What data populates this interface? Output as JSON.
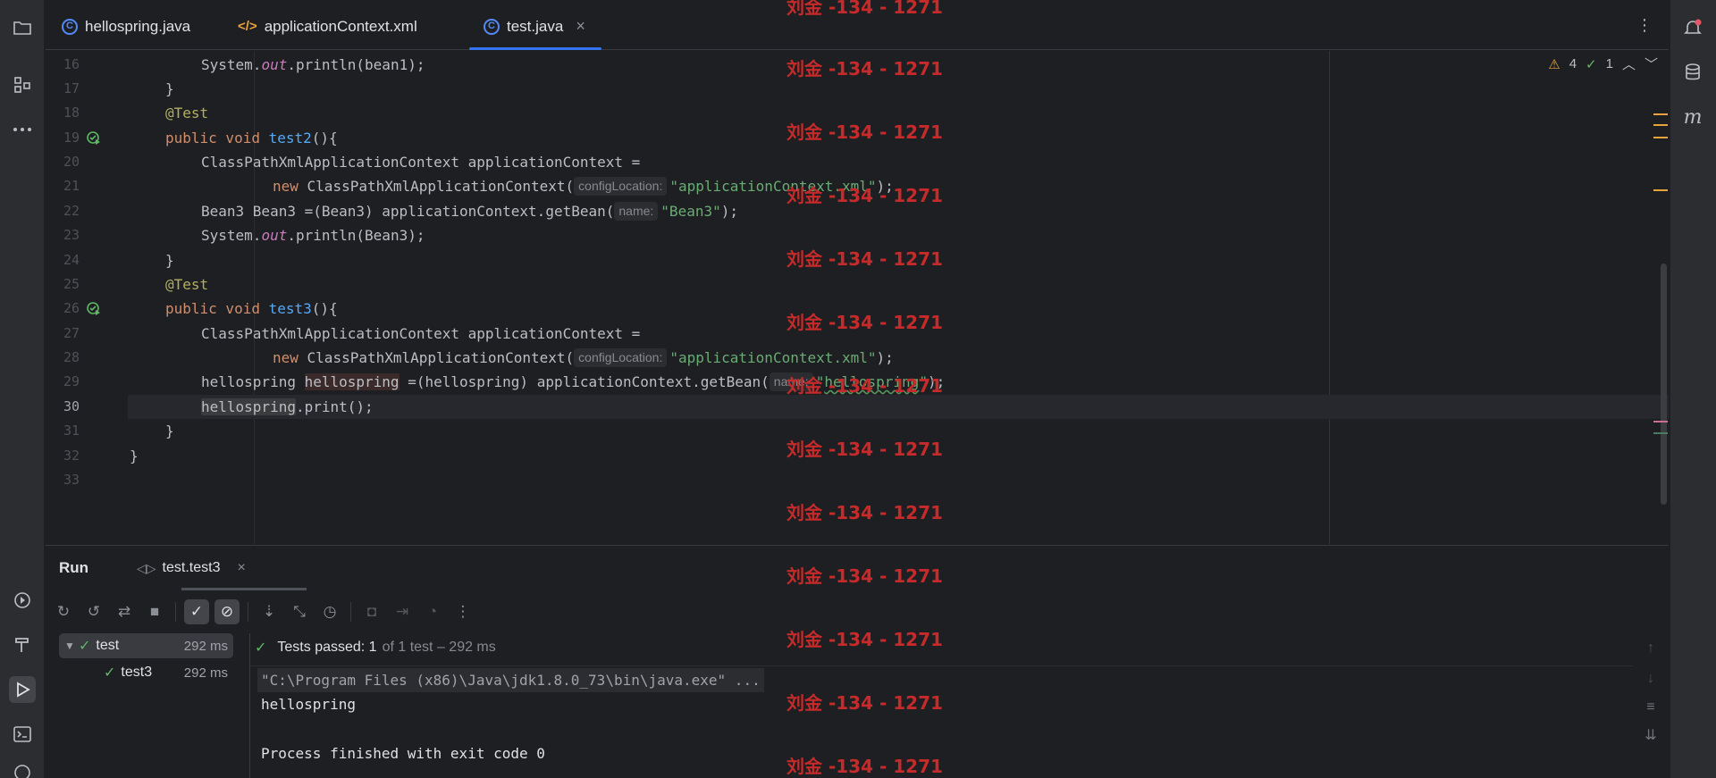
{
  "tabs": [
    {
      "label": "hellospring.java",
      "icon": "java-class-icon"
    },
    {
      "label": "applicationContext.xml",
      "icon": "xml-file-icon"
    },
    {
      "label": "test.java",
      "icon": "java-class-icon",
      "close": "×"
    }
  ],
  "inspections": {
    "warnings": "4",
    "weak_warnings": "1"
  },
  "editor": {
    "lines": [
      {
        "n": "16",
        "code": "System.out.println(bean1);"
      },
      {
        "n": "17",
        "code": "}"
      },
      {
        "n": "18",
        "code": "@Test"
      },
      {
        "n": "19",
        "code": "public void test2(){"
      },
      {
        "n": "20",
        "code": "ClassPathXmlApplicationContext applicationContext ="
      },
      {
        "n": "21",
        "code": "new ClassPathXmlApplicationContext( configLocation: \"applicationContext.xml\");"
      },
      {
        "n": "22",
        "code": "Bean3 Bean3 =(Bean3) applicationContext.getBean( name: \"Bean3\");"
      },
      {
        "n": "23",
        "code": "System.out.println(Bean3);"
      },
      {
        "n": "24",
        "code": "}"
      },
      {
        "n": "25",
        "code": "@Test"
      },
      {
        "n": "26",
        "code": "public void test3(){"
      },
      {
        "n": "27",
        "code": "ClassPathXmlApplicationContext applicationContext ="
      },
      {
        "n": "28",
        "code": "new ClassPathXmlApplicationContext( configLocation: \"applicationContext.xml\");"
      },
      {
        "n": "29",
        "code": "hellospring hellospring =(hellospring) applicationContext.getBean( name: \"hellospring\");"
      },
      {
        "n": "30",
        "code": "hellospring.print();"
      },
      {
        "n": "31",
        "code": "}"
      },
      {
        "n": "32",
        "code": "}"
      },
      {
        "n": "33",
        "code": ""
      }
    ],
    "tokens": {
      "system": "System.",
      "out": "out",
      "println_bean1": ".println(bean1);",
      "brace_close": "}",
      "at_test": "@Test",
      "public_void": "public void ",
      "test2": "test2",
      "test3": "test3",
      "parens_open": "(){",
      "cpx_decl": "ClassPathXmlApplicationContext applicationContext =",
      "new_kw": "new",
      "cpx_ctor": " ClassPathXmlApplicationContext(",
      "hint_config": "configLocation:",
      "str_ctx": "\"applicationContext.xml\"",
      "semi_close": ");",
      "bean3_decl": "Bean3 Bean3 =(Bean3) applicationContext.getBean(",
      "hint_name": "name:",
      "str_bean3": "\"Bean3\"",
      "println_bean3": ".println(Bean3);",
      "hs_type": "hellospring ",
      "hs_var": "hellospring",
      "hs_cast": " =(hellospring) applicationContext.getBean(",
      "str_hs_open": "\"",
      "str_hs_word": "hellospring",
      "str_hs_close": "\"",
      "hs_call_var": "hellospring",
      "hs_print": ".print();"
    }
  },
  "run": {
    "title": "Run",
    "tab_label": "test.test3",
    "close": "×",
    "tests_status_bold": "Tests passed: 1",
    "tests_status_rest": "of 1 test – 292 ms",
    "tree": [
      {
        "label": "test",
        "time": "292 ms"
      },
      {
        "label": "test3",
        "time": "292 ms"
      }
    ],
    "output": [
      "\"C:\\Program Files (x86)\\Java\\jdk1.8.0_73\\bin\\java.exe\" ...",
      "hellospring",
      "",
      "Process finished with exit code 0"
    ]
  },
  "watermark": "刘金 -134 - 1271"
}
